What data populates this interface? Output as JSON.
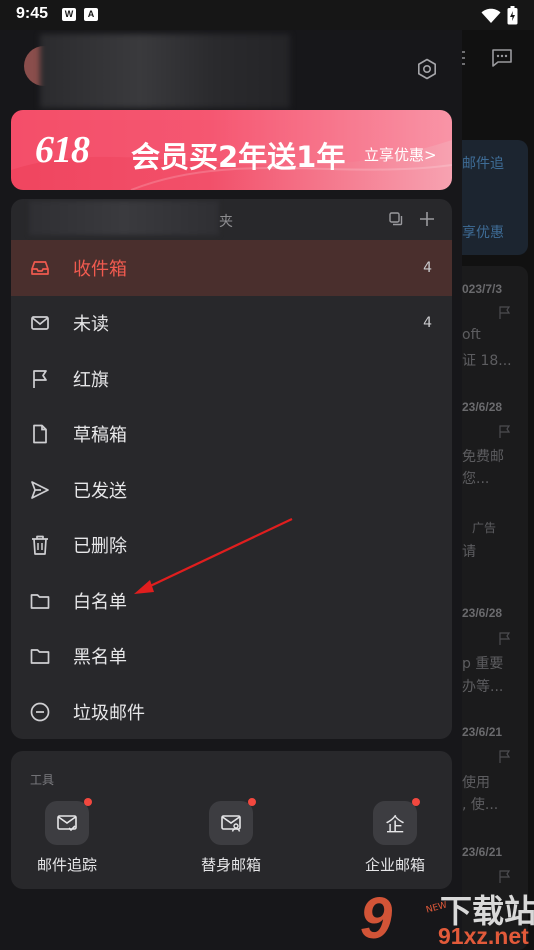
{
  "status_bar": {
    "time": "9:45",
    "app_icon_1": "W",
    "app_icon_2": "A"
  },
  "background": {
    "cards": [
      {
        "text_top": "邮件追",
        "text_bottom": "享优惠"
      },
      {
        "date": "023/7/3",
        "line1": "oft",
        "line2": "证 18..."
      },
      {
        "date": "23/6/28",
        "line1": "免费邮",
        "line2": "您..."
      },
      {
        "ad": "广告",
        "line1": "请"
      },
      {
        "date": "23/6/28",
        "line1": "p 重要",
        "line2": "办等..."
      },
      {
        "date": "23/6/21",
        "line1": "使用",
        "line2": ", 使..."
      },
      {
        "date": "23/6/21"
      }
    ]
  },
  "promo": {
    "badge": "618",
    "title": "会员买2年送1年",
    "cta": "立享优惠>"
  },
  "folders": {
    "header_label": "夹",
    "items": [
      {
        "label": "收件箱",
        "count": "4",
        "icon": "inbox-icon",
        "active": true
      },
      {
        "label": "未读",
        "count": "4",
        "icon": "mail-icon"
      },
      {
        "label": "红旗",
        "count": "",
        "icon": "flag-icon"
      },
      {
        "label": "草稿箱",
        "count": "",
        "icon": "draft-icon"
      },
      {
        "label": "已发送",
        "count": "",
        "icon": "send-icon"
      },
      {
        "label": "已删除",
        "count": "",
        "icon": "trash-icon"
      },
      {
        "label": "白名单",
        "count": "",
        "icon": "folder-icon"
      },
      {
        "label": "黑名单",
        "count": "",
        "icon": "folder-icon"
      },
      {
        "label": "垃圾邮件",
        "count": "",
        "icon": "spam-icon"
      }
    ]
  },
  "tools": {
    "label": "工具",
    "items": [
      {
        "label": "邮件追踪",
        "icon": "mail-track-icon"
      },
      {
        "label": "替身邮箱",
        "icon": "alias-mailbox-icon"
      },
      {
        "label": "企业邮箱",
        "icon": "enterprise-mailbox-icon",
        "glyph": "企"
      }
    ]
  },
  "colors": {
    "accent_red": "#f05a4f",
    "active_row_bg": "#4a2f2d",
    "panel_bg": "#28282b",
    "annotation_arrow": "#e01e1e"
  },
  "watermark": {
    "logo": "9",
    "top": "下载站",
    "bottom": "91xz.net",
    "badge": "NEW"
  }
}
